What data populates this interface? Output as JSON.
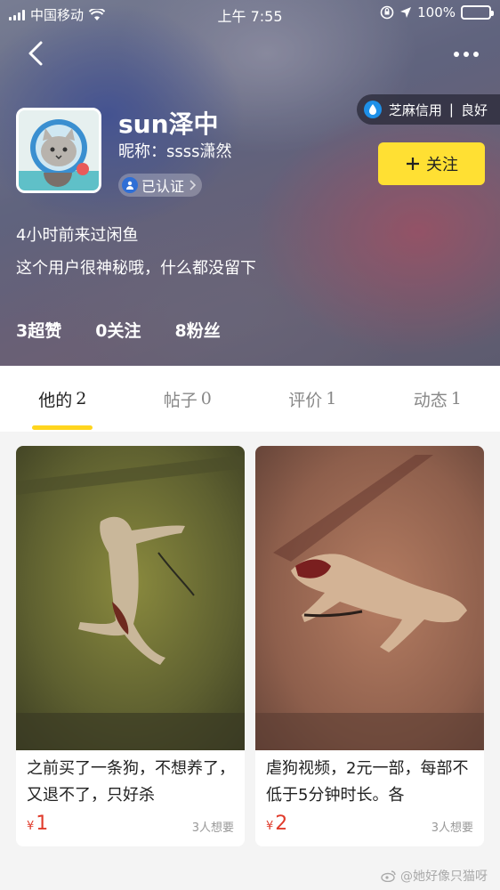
{
  "status_bar": {
    "carrier": "中国移动",
    "time": "上午 7:55",
    "battery_text": "100%",
    "battery_level": 1.0
  },
  "profile": {
    "credit_label": "芝麻信用",
    "credit_level": "良好",
    "username": "sun泽中",
    "nickname": "昵称：ssss潇然",
    "verified_label": "已认证",
    "follow_label": "关注",
    "last_seen": "4小时前来过闲鱼",
    "bio": "这个用户很神秘哦，什么都没留下",
    "stats": [
      {
        "label": "3超赞"
      },
      {
        "label": "0关注"
      },
      {
        "label": "8粉丝"
      }
    ]
  },
  "tabs": [
    {
      "label": "他的",
      "count": "2",
      "active": true
    },
    {
      "label": "帖子",
      "count": "0",
      "active": false
    },
    {
      "label": "评价",
      "count": "1",
      "active": false
    },
    {
      "label": "动态",
      "count": "1",
      "active": false
    }
  ],
  "items": [
    {
      "title": "之前买了一条狗，不想养了，又退不了，只好杀",
      "currency": "¥",
      "price": "1",
      "wants": "3人想要"
    },
    {
      "title": "虐狗视频，2元一部，每部不低于5分钟时长。各",
      "currency": "¥",
      "price": "2",
      "wants": "3人想要"
    }
  ],
  "watermark": "@她好像只猫呀",
  "colors": {
    "accent_yellow": "#ffe033",
    "price_red": "#e03b2b",
    "tab_indicator": "#ffd51e"
  }
}
